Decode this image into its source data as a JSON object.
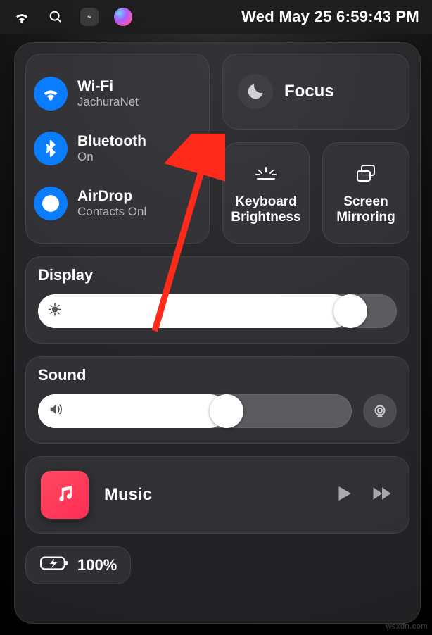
{
  "menubar": {
    "datetime": "Wed May 25  6:59:43 PM"
  },
  "connectivity": {
    "wifi": {
      "label": "Wi-Fi",
      "status": "JachuraNet"
    },
    "bluetooth": {
      "label": "Bluetooth",
      "status": "On"
    },
    "airdrop": {
      "label": "AirDrop",
      "status": "Contacts Onl"
    }
  },
  "focus": {
    "label": "Focus"
  },
  "keyboard_brightness": {
    "label": "Keyboard Brightness"
  },
  "screen_mirroring": {
    "label": "Screen Mirroring"
  },
  "display": {
    "title": "Display",
    "value_pct": 87
  },
  "sound": {
    "title": "Sound",
    "value_pct": 60
  },
  "music": {
    "label": "Music"
  },
  "battery": {
    "label": "100%"
  },
  "watermark": "wsxdn.com"
}
